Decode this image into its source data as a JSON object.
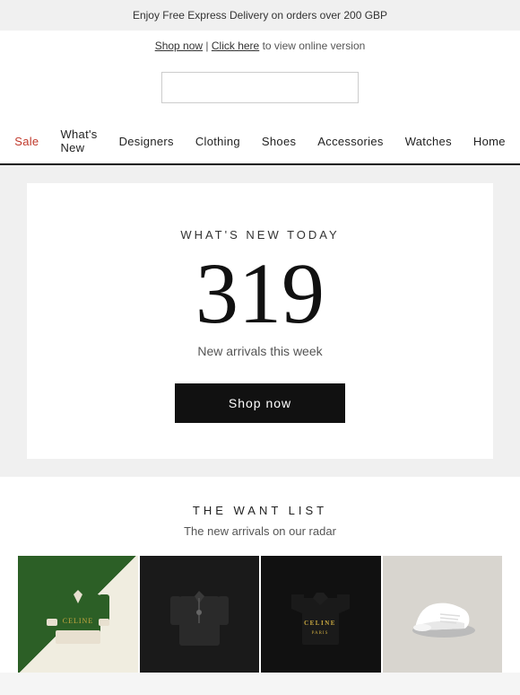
{
  "banner": {
    "text": "Enjoy Free Express Delivery on orders over 200 GBP"
  },
  "links_bar": {
    "shop_now_label": "Shop now",
    "separator": " | ",
    "click_here_label": "Click here",
    "suffix_text": " to view online version"
  },
  "nav": {
    "items": [
      {
        "label": "Sale",
        "key": "sale",
        "class": "sale"
      },
      {
        "label": "What's New",
        "key": "whats-new"
      },
      {
        "label": "Designers",
        "key": "designers"
      },
      {
        "label": "Clothing",
        "key": "clothing"
      },
      {
        "label": "Shoes",
        "key": "shoes"
      },
      {
        "label": "Accessories",
        "key": "accessories"
      },
      {
        "label": "Watches",
        "key": "watches"
      },
      {
        "label": "Home",
        "key": "home"
      }
    ]
  },
  "hero": {
    "subtitle": "WHAT'S NEW TODAY",
    "number": "319",
    "description": "New arrivals this week",
    "button_label": "Shop now"
  },
  "want_list": {
    "title": "THE WANT LIST",
    "subtitle": "The new arrivals on our radar"
  },
  "products": [
    {
      "id": 1,
      "brand": "CELINE",
      "color": "green-varsity"
    },
    {
      "id": 2,
      "brand": "",
      "color": "dark-pullover"
    },
    {
      "id": 3,
      "brand": "CELINE",
      "color": "black-tee"
    },
    {
      "id": 4,
      "brand": "",
      "color": "white-shoe"
    }
  ]
}
